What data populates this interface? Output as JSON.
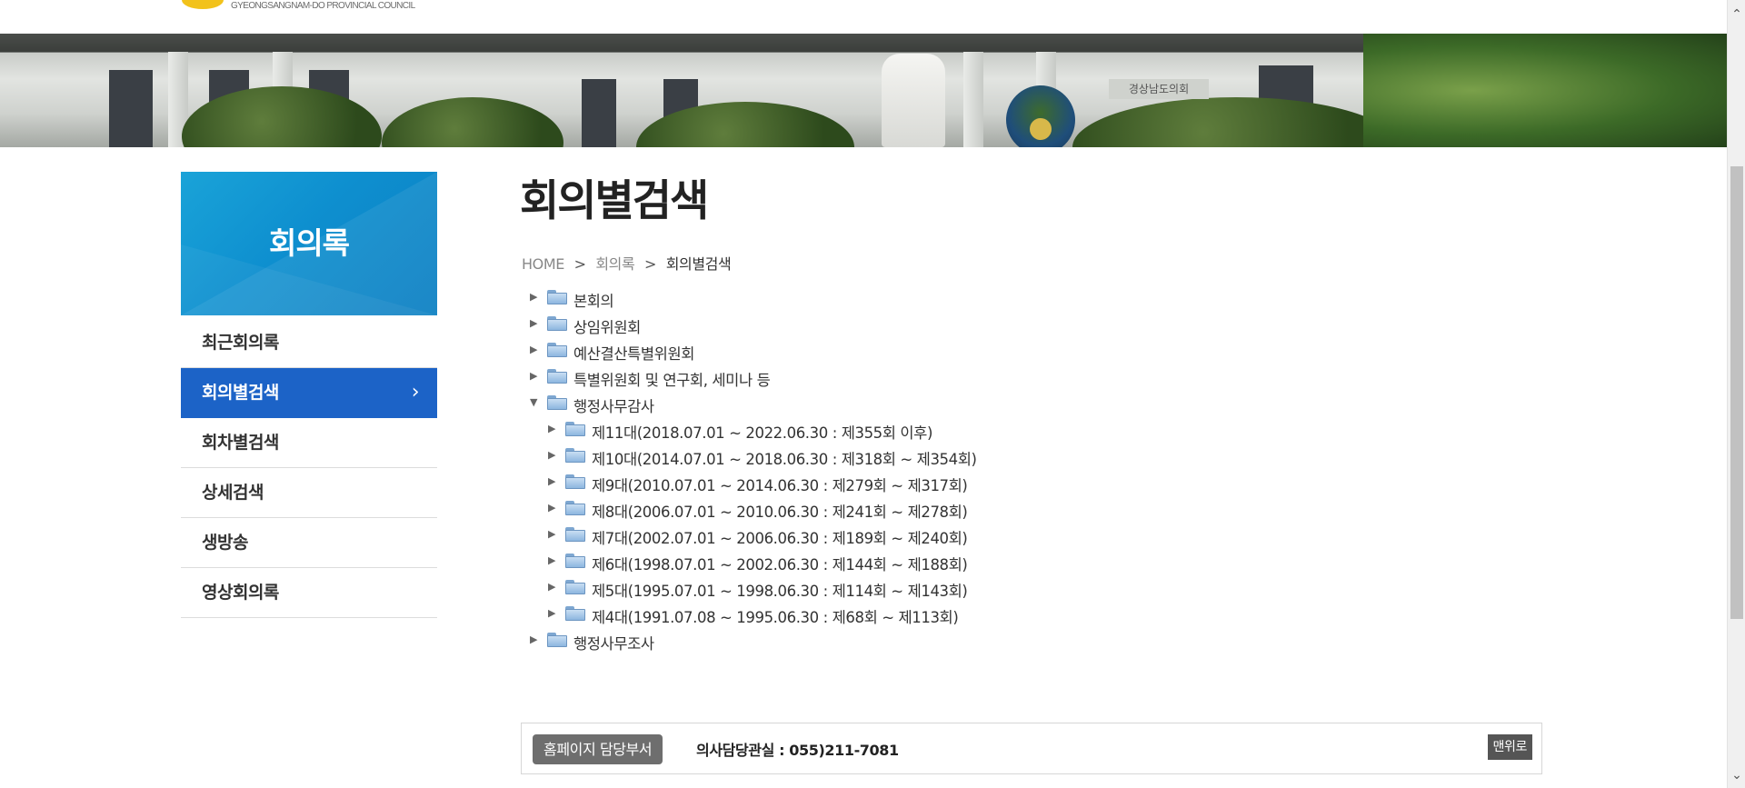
{
  "header": {
    "logo_subtitle": "GYEONGSANGNAM-DO PROVINCIAL COUNCIL",
    "banner_sign": "경상남도의회"
  },
  "sidebar": {
    "title": "회의록",
    "items": [
      {
        "label": "최근회의록",
        "active": false
      },
      {
        "label": "회의별검색",
        "active": true
      },
      {
        "label": "회차별검색",
        "active": false
      },
      {
        "label": "상세검색",
        "active": false
      },
      {
        "label": "생방송",
        "active": false
      },
      {
        "label": "영상회의록",
        "active": false
      }
    ],
    "active_arrow": "›"
  },
  "main": {
    "title": "회의별검색",
    "breadcrumb": {
      "home": "HOME",
      "separator": ">",
      "level1": "회의록",
      "current": "회의별검색"
    },
    "tree": [
      {
        "label": "본회의",
        "expanded": false,
        "children": []
      },
      {
        "label": "상임위원회",
        "expanded": false,
        "children": []
      },
      {
        "label": "예산결산특별위원회",
        "expanded": false,
        "children": []
      },
      {
        "label": "특별위원회 및 연구회, 세미나 등",
        "expanded": false,
        "children": []
      },
      {
        "label": "행정사무감사",
        "expanded": true,
        "children": [
          {
            "label": "제11대(2018.07.01 ~ 2022.06.30 : 제355회 이후)"
          },
          {
            "label": "제10대(2014.07.01 ~ 2018.06.30 : 제318회 ~ 제354회)"
          },
          {
            "label": "제9대(2010.07.01 ~ 2014.06.30 : 제279회 ~ 제317회)"
          },
          {
            "label": "제8대(2006.07.01 ~ 2010.06.30 : 제241회 ~ 제278회)"
          },
          {
            "label": "제7대(2002.07.01 ~ 2006.06.30 : 제189회 ~ 제240회)"
          },
          {
            "label": "제6대(1998.07.01 ~ 2002.06.30 : 제144회 ~ 제188회)"
          },
          {
            "label": "제5대(1995.07.01 ~ 1998.06.30 : 제114회 ~ 제143회)"
          },
          {
            "label": "제4대(1991.07.08 ~ 1995.06.30 : 제68회 ~ 제113회)"
          }
        ]
      },
      {
        "label": "행정사무조사",
        "expanded": false,
        "children": []
      }
    ],
    "twisty_closed": "▶",
    "twisty_open": "▼"
  },
  "footer": {
    "dept_button": "홈페이지 담당부서",
    "contact": "의사담당관실 : 055)211-7081",
    "top_button": "맨위로"
  },
  "scrollbar": {
    "up_icon": "chevron-up-icon",
    "down_icon": "chevron-down-icon"
  },
  "colors": {
    "sidebar_active": "#1c63c7",
    "sidebar_header": "#0e8fcf",
    "dept_button": "#6e6e6e"
  }
}
